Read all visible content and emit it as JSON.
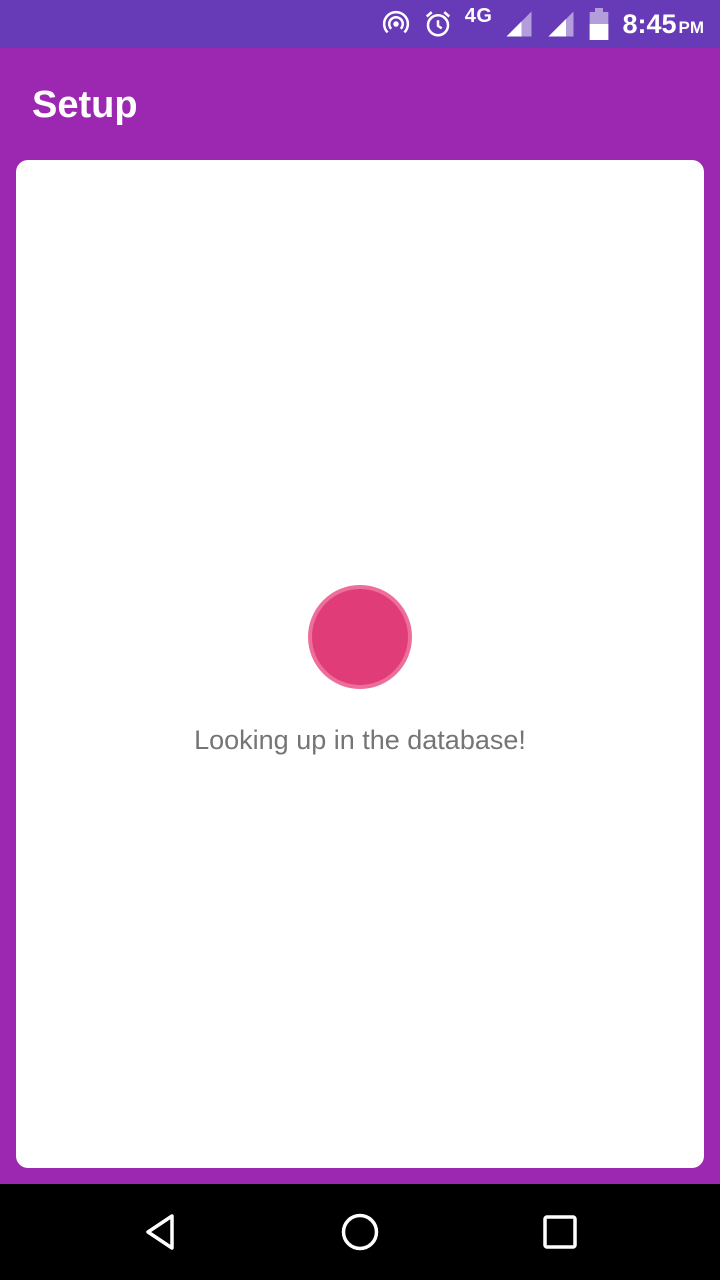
{
  "status_bar": {
    "network_label": "4G",
    "time": "8:45",
    "time_suffix": "PM",
    "icons": [
      "hotspot-icon",
      "alarm-icon",
      "signal-icon",
      "signal-icon",
      "battery-icon"
    ]
  },
  "app_bar": {
    "title": "Setup"
  },
  "content": {
    "message": "Looking up in the database!"
  },
  "nav_bar": {
    "buttons": [
      "back-icon",
      "home-icon",
      "recents-icon"
    ]
  },
  "colors": {
    "status_bar": "#673ab7",
    "primary": "#9c27b0",
    "accent": "#e03d78",
    "message_text": "#757575"
  }
}
